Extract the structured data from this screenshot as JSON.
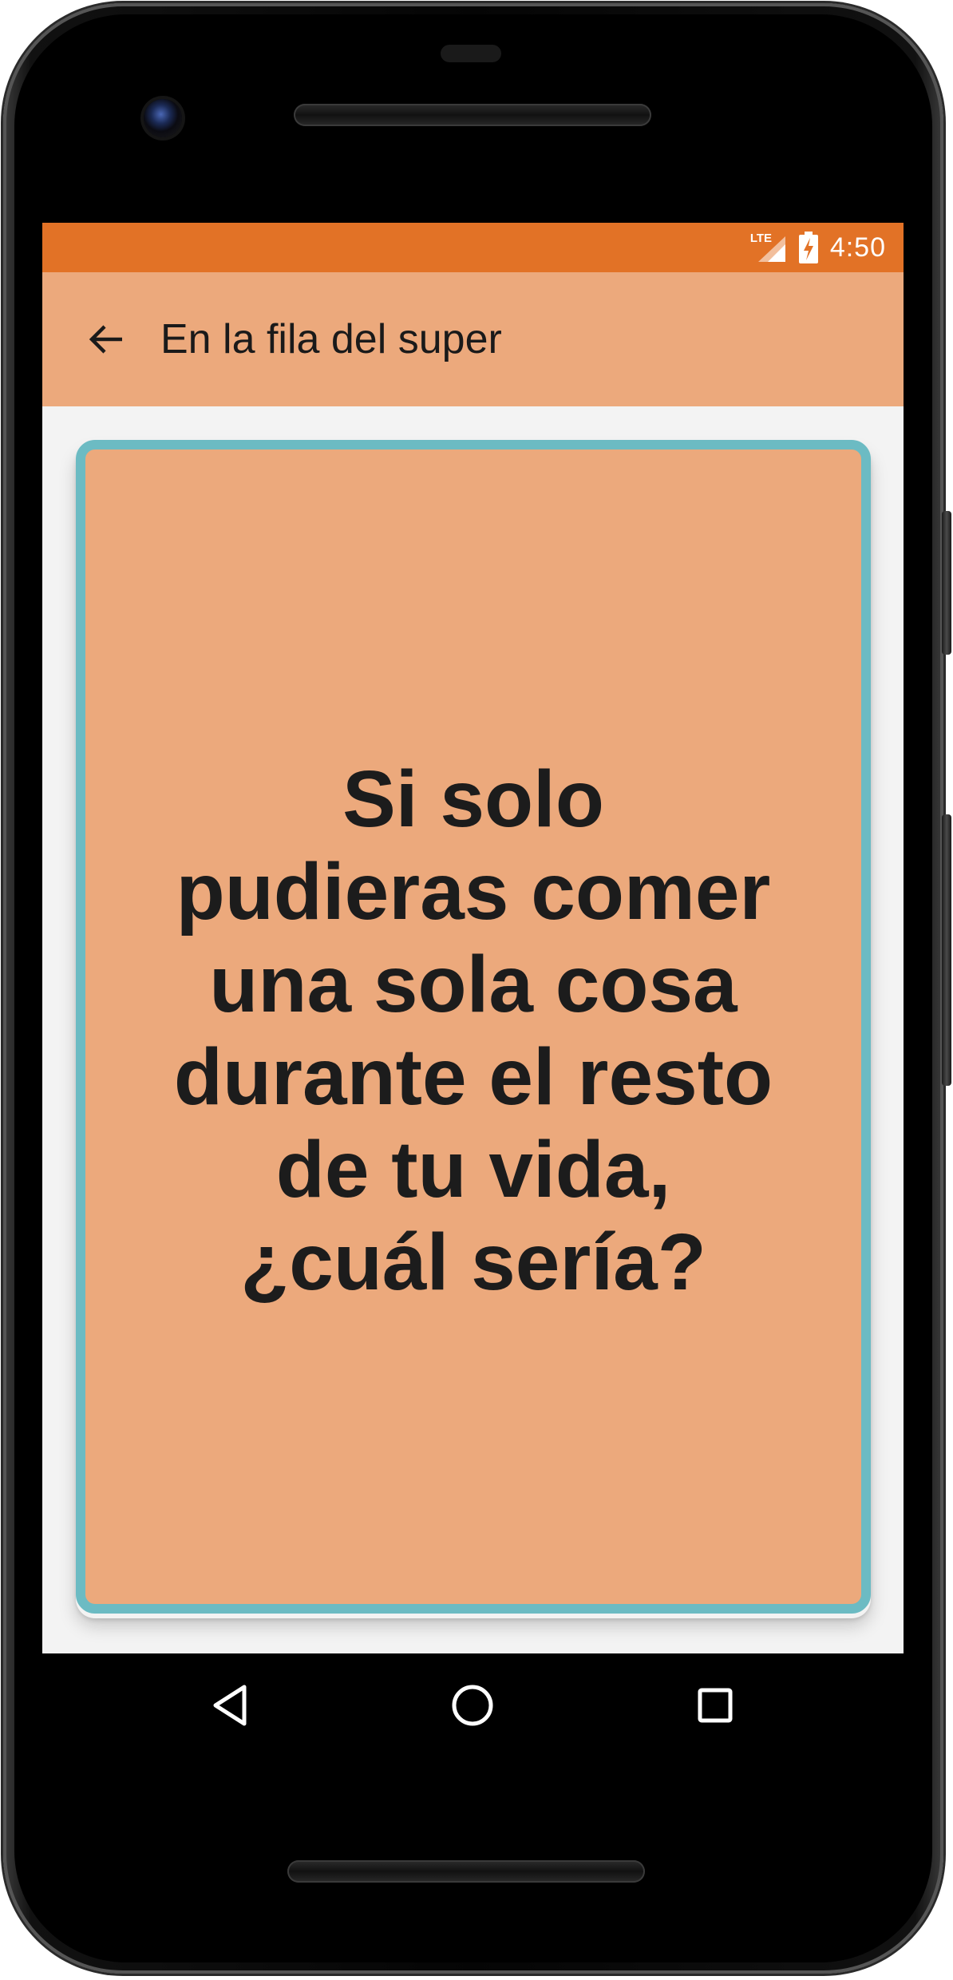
{
  "status_bar": {
    "network": "LTE",
    "time": "4:50",
    "icons": [
      "lte-icon",
      "signal-icon",
      "battery-charging-icon"
    ]
  },
  "app_bar": {
    "back_icon": "arrow-back-icon",
    "title": "En la fila del super"
  },
  "card": {
    "question": "Si solo pudieras comer una sola cosa durante el resto de tu vida, ¿cuál sería?"
  },
  "nav_bar": {
    "icons": [
      "back-triangle-icon",
      "home-circle-icon",
      "recents-square-icon"
    ]
  },
  "colors": {
    "status_bar": "#e27226",
    "app_bar": "#eca97c",
    "card_fill": "#eca97c",
    "card_border": "#6cbbc3",
    "screen_bg": "#f3f3f3"
  }
}
